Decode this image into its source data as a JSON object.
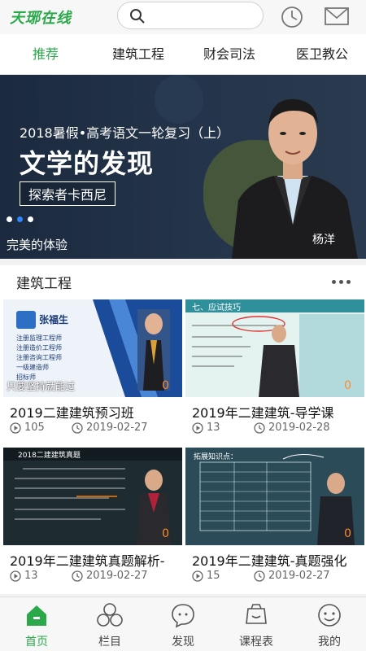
{
  "header": {
    "logo": "天琊在线",
    "search_placeholder": ""
  },
  "tabs": [
    {
      "label": "推荐",
      "active": true
    },
    {
      "label": "建筑工程",
      "active": false
    },
    {
      "label": "财会司法",
      "active": false
    },
    {
      "label": "医卫教公",
      "active": false
    }
  ],
  "banner": {
    "subtitle": "2018暑假•高考语文一轮复习（上）",
    "title": "文学的发现",
    "tag": "探索者卡西尼",
    "teacher": "杨洋",
    "caption": "完美的体验",
    "slide_count": 3,
    "active_slide": 2
  },
  "section": {
    "title": "建筑工程"
  },
  "courses": [
    {
      "title": "2019二建建筑预习班",
      "views": "105",
      "date": "2019-02-27",
      "badge": "0",
      "thumb_teacher": "张福生",
      "thumb_lines": [
        "注册监理工程师",
        "注册造价工程师",
        "注册咨询工程师",
        "一级建造师",
        "招标师"
      ],
      "thumb_overlay": "只要坚持就能过"
    },
    {
      "title": "2019年二建建筑-导学课",
      "views": "13",
      "date": "2019-02-28",
      "badge": "0",
      "thumb_header": "七、应试技巧"
    },
    {
      "title": "2019年二建建筑真题解析-",
      "views": "13",
      "date": "2019-02-27",
      "badge": "0",
      "thumb_header": "2018二建建筑真题"
    },
    {
      "title": "2019年二建建筑-真题强化",
      "views": "15",
      "date": "2019-02-27",
      "badge": "0",
      "thumb_header": "拓展知识点："
    }
  ],
  "bottom_nav": [
    {
      "label": "首页",
      "icon": "home-icon",
      "active": true
    },
    {
      "label": "栏目",
      "icon": "circles-icon",
      "active": false
    },
    {
      "label": "发现",
      "icon": "chat-bubble-icon",
      "active": false
    },
    {
      "label": "课程表",
      "icon": "schedule-icon",
      "active": false
    },
    {
      "label": "我的",
      "icon": "profile-icon",
      "active": false
    }
  ],
  "colors": {
    "accent": "#2aa84a",
    "badge": "#ff8a2a",
    "dot_active": "#2f86ff"
  }
}
